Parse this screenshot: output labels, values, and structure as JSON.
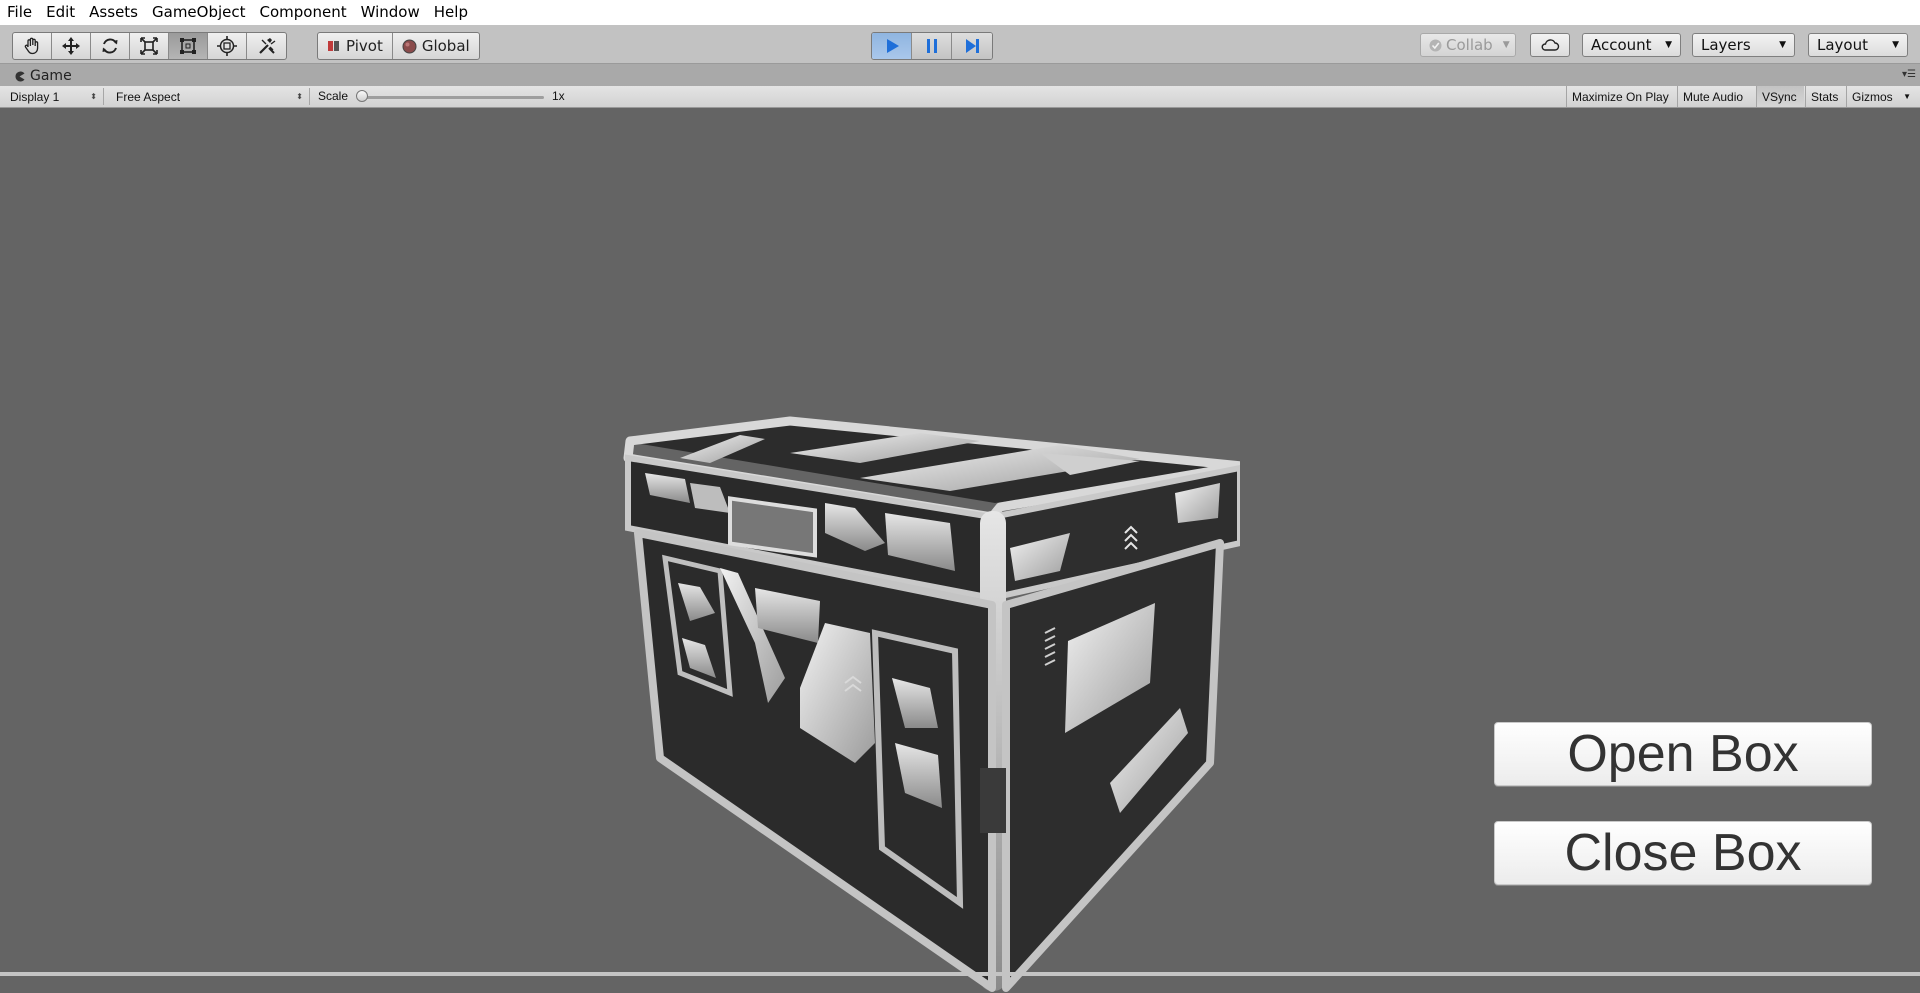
{
  "menu": [
    "File",
    "Edit",
    "Assets",
    "GameObject",
    "Component",
    "Window",
    "Help"
  ],
  "toolbar": {
    "transform_tools": [
      "hand-icon",
      "move-icon",
      "rotate-icon",
      "scale-icon",
      "rect-icon",
      "transform-icon",
      "custom-tool-icon"
    ],
    "pivot_label": "Pivot",
    "global_label": "Global",
    "play_controls": [
      "play-icon",
      "pause-icon",
      "step-icon"
    ],
    "collab_label": "Collab",
    "account_label": "Account",
    "layers_label": "Layers",
    "layout_label": "Layout",
    "play_active_color": "#8fb5e0"
  },
  "game_tab": {
    "title": "Game"
  },
  "game_toolbar": {
    "display": "Display 1",
    "aspect": "Free Aspect",
    "scale_label": "Scale",
    "scale_value": "1x",
    "maximize_on_play": "Maximize On Play",
    "mute_audio": "Mute Audio",
    "vsync": "VSync",
    "stats": "Stats",
    "gizmos": "Gizmos"
  },
  "scene": {
    "background_color": "#646464",
    "open_button": "Open Box",
    "close_button": "Close Box"
  }
}
